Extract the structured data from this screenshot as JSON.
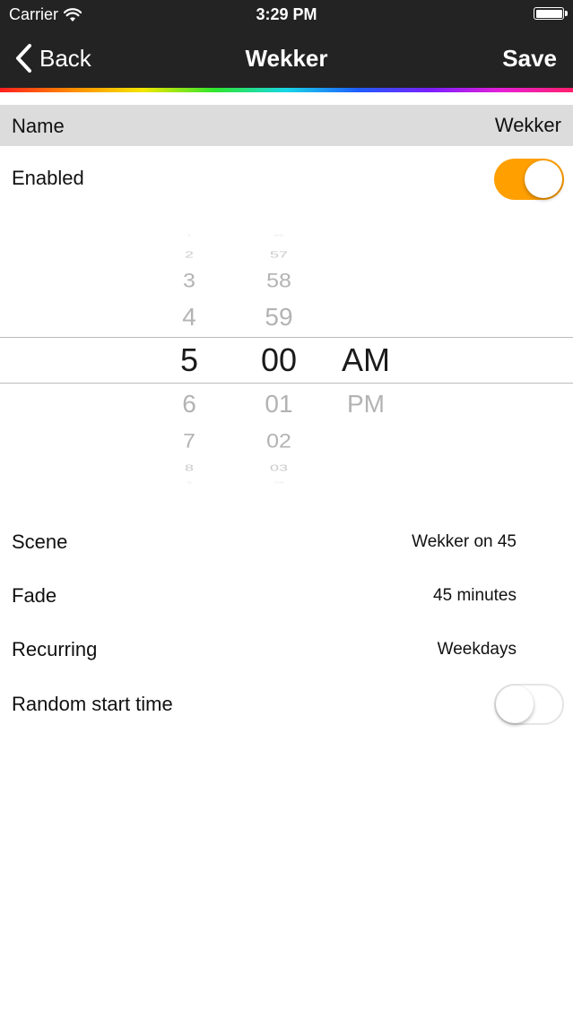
{
  "status_bar": {
    "carrier": "Carrier",
    "time": "3:29 PM",
    "wifi_icon": "wifi-icon",
    "battery_icon": "battery-icon"
  },
  "nav": {
    "back_label": "Back",
    "title": "Wekker",
    "save_label": "Save"
  },
  "colors": {
    "nav_background": "#232323",
    "accent": "#ff9f00",
    "name_row_background": "#dcdcdc"
  },
  "name": {
    "label": "Name",
    "value": "Wekker"
  },
  "enabled": {
    "label": "Enabled",
    "on": true
  },
  "time_picker": {
    "hours": [
      "1",
      "2",
      "3",
      "4",
      "5",
      "6",
      "7",
      "8",
      "9"
    ],
    "minutes": [
      "56",
      "57",
      "58",
      "59",
      "00",
      "01",
      "02",
      "03",
      "04"
    ],
    "periods": [
      "AM",
      "PM"
    ],
    "selected_hour": "5",
    "selected_minute": "00",
    "selected_period": "AM"
  },
  "settings": [
    {
      "label": "Scene",
      "value": "Wekker on 45"
    },
    {
      "label": "Fade",
      "value": "45 minutes"
    },
    {
      "label": "Recurring",
      "value": "Weekdays"
    }
  ],
  "random_start": {
    "label": "Random start time",
    "on": false
  }
}
